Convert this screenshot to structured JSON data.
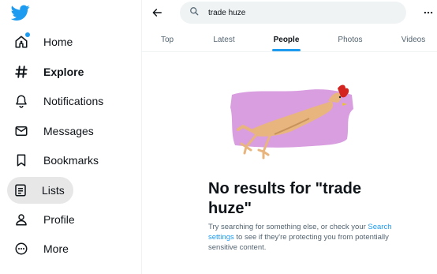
{
  "nav": {
    "items": [
      {
        "label": "Home",
        "icon": "home-icon"
      },
      {
        "label": "Explore",
        "icon": "hashtag-icon",
        "active_bold": true
      },
      {
        "label": "Notifications",
        "icon": "bell-icon"
      },
      {
        "label": "Messages",
        "icon": "envelope-icon"
      },
      {
        "label": "Bookmarks",
        "icon": "bookmark-icon"
      },
      {
        "label": "Lists",
        "icon": "list-icon"
      },
      {
        "label": "Profile",
        "icon": "person-icon"
      },
      {
        "label": "More",
        "icon": "more-circle-icon"
      }
    ]
  },
  "search": {
    "query": "trade huze"
  },
  "tabs": [
    {
      "label": "Top"
    },
    {
      "label": "Latest"
    },
    {
      "label": "People"
    },
    {
      "label": "Photos"
    },
    {
      "label": "Videos"
    }
  ],
  "empty": {
    "title": "No results for \"trade huze\"",
    "hint_before": "Try searching for something else, or check your ",
    "hint_link": "Search settings",
    "hint_after": " to see if they're protecting you from potentially sensitive content."
  },
  "colors": {
    "accent": "#1d9bf0",
    "text": "#0f1419",
    "muted": "#536471",
    "lists_highlight": "#e7e7e8",
    "illustration_bg": "#d99ee0"
  }
}
